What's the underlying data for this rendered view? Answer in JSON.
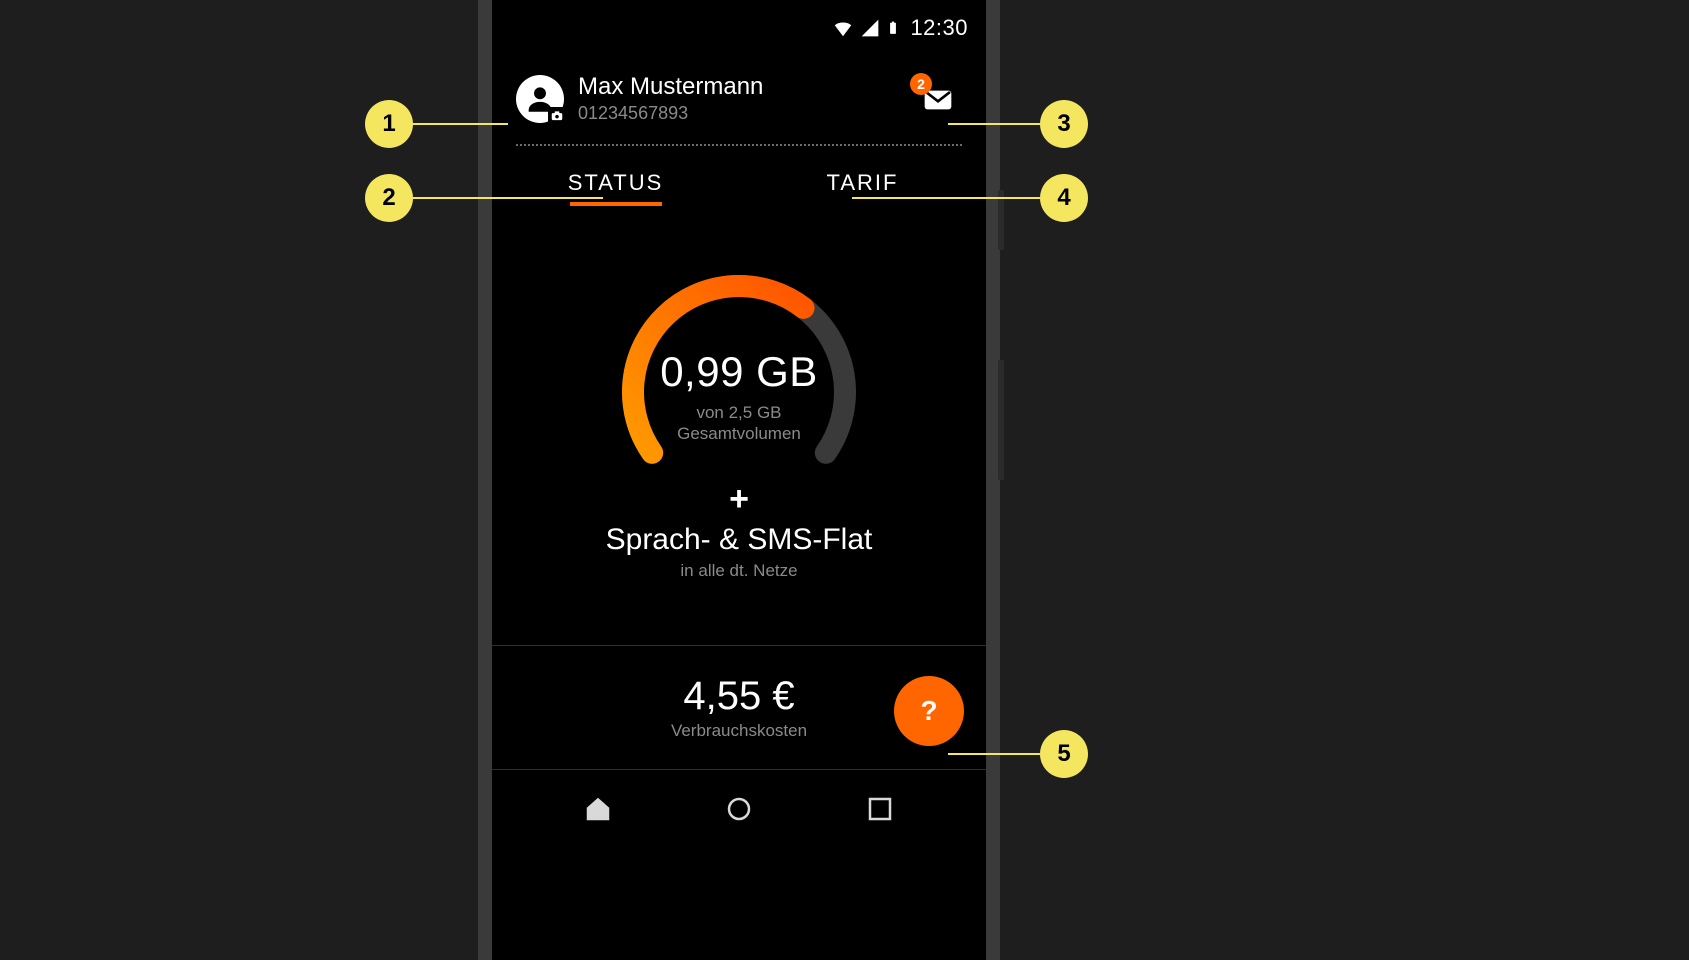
{
  "status_bar": {
    "time": "12:30"
  },
  "user": {
    "name": "Max Mustermann",
    "phone": "01234567893"
  },
  "messages": {
    "badge_count": "2"
  },
  "tabs": {
    "status": "STATUS",
    "tarif": "TARIF"
  },
  "data_usage": {
    "value": "0,99 GB",
    "sub_line1": "von 2,5 GB",
    "sub_line2": "Gesamtvolumen",
    "gauge_fraction": 0.65
  },
  "feature": {
    "plus": "+",
    "title": "Sprach- & SMS-Flat",
    "subtitle": "in alle dt. Netze"
  },
  "cost": {
    "value": "4,55 €",
    "label": "Verbrauchskosten"
  },
  "help": {
    "label": "?"
  },
  "callouts": {
    "c1": "1",
    "c2": "2",
    "c3": "3",
    "c4": "4",
    "c5": "5"
  },
  "colors": {
    "accent": "#ff6600",
    "badge": "#f4e65f"
  }
}
